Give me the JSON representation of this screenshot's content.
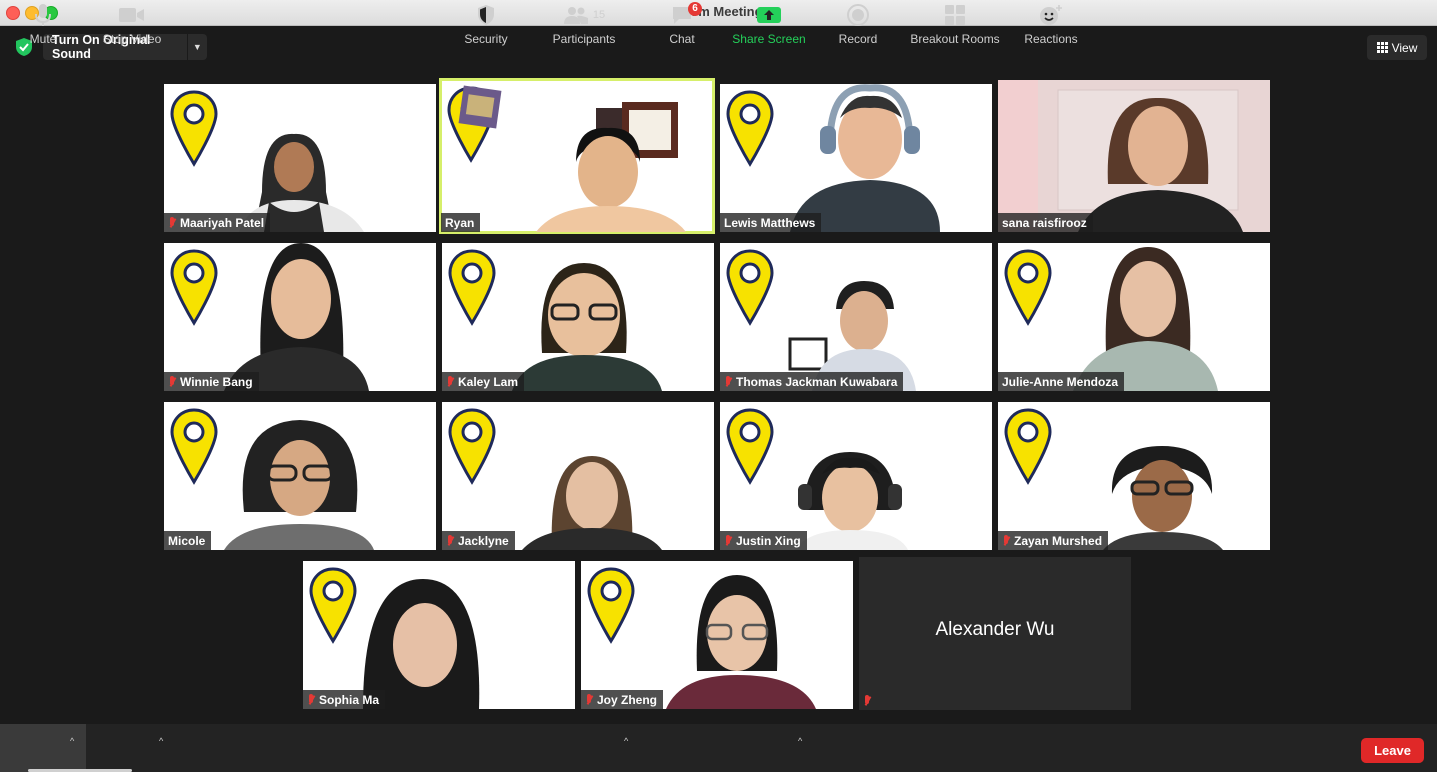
{
  "window": {
    "title": "Zoom Meeting"
  },
  "top_bar": {
    "sound_button_label": "Turn On Original Sound",
    "view_label": "View"
  },
  "participants_grid": [
    {
      "name": "Maariyah Patel",
      "muted": true,
      "background": "pin"
    },
    {
      "name": "Ryan",
      "muted": false,
      "background": "pin",
      "active_speaker": true
    },
    {
      "name": "Lewis Matthews",
      "muted": false,
      "background": "pin"
    },
    {
      "name": "sana raisfirooz",
      "muted": false,
      "background": "room"
    },
    {
      "name": "Winnie Bang",
      "muted": true,
      "background": "pin"
    },
    {
      "name": "Kaley Lam",
      "muted": true,
      "background": "pin"
    },
    {
      "name": "Thomas Jackman Kuwabara",
      "muted": true,
      "background": "pin"
    },
    {
      "name": "Julie-Anne Mendoza",
      "muted": false,
      "background": "room"
    },
    {
      "name": "Micole",
      "muted": false,
      "background": "pin"
    },
    {
      "name": "Jacklyne",
      "muted": true,
      "background": "pin"
    },
    {
      "name": "Justin Xing",
      "muted": true,
      "background": "pin"
    },
    {
      "name": "Zayan Murshed",
      "muted": true,
      "background": "pin"
    },
    {
      "name": "Sophia Ma",
      "muted": true,
      "background": "pin"
    },
    {
      "name": "Joy Zheng",
      "muted": true,
      "background": "pin"
    },
    {
      "name": "Alexander Wu",
      "muted": true,
      "video_off": true
    }
  ],
  "toolbar": {
    "mute_label": "Mute",
    "stop_video_label": "Stop Video",
    "security_label": "Security",
    "participants_label": "Participants",
    "participants_count": "15",
    "chat_label": "Chat",
    "chat_badge": "6",
    "share_screen_label": "Share Screen",
    "record_label": "Record",
    "breakout_rooms_label": "Breakout Rooms",
    "reactions_label": "Reactions",
    "leave_label": "Leave"
  },
  "colors": {
    "active_speaker_border": "#d6ef6a",
    "share_green": "#24d05a",
    "leave_red": "#e02828",
    "pin_yellow": "#f7e200",
    "pin_outline": "#1f2a5a"
  }
}
